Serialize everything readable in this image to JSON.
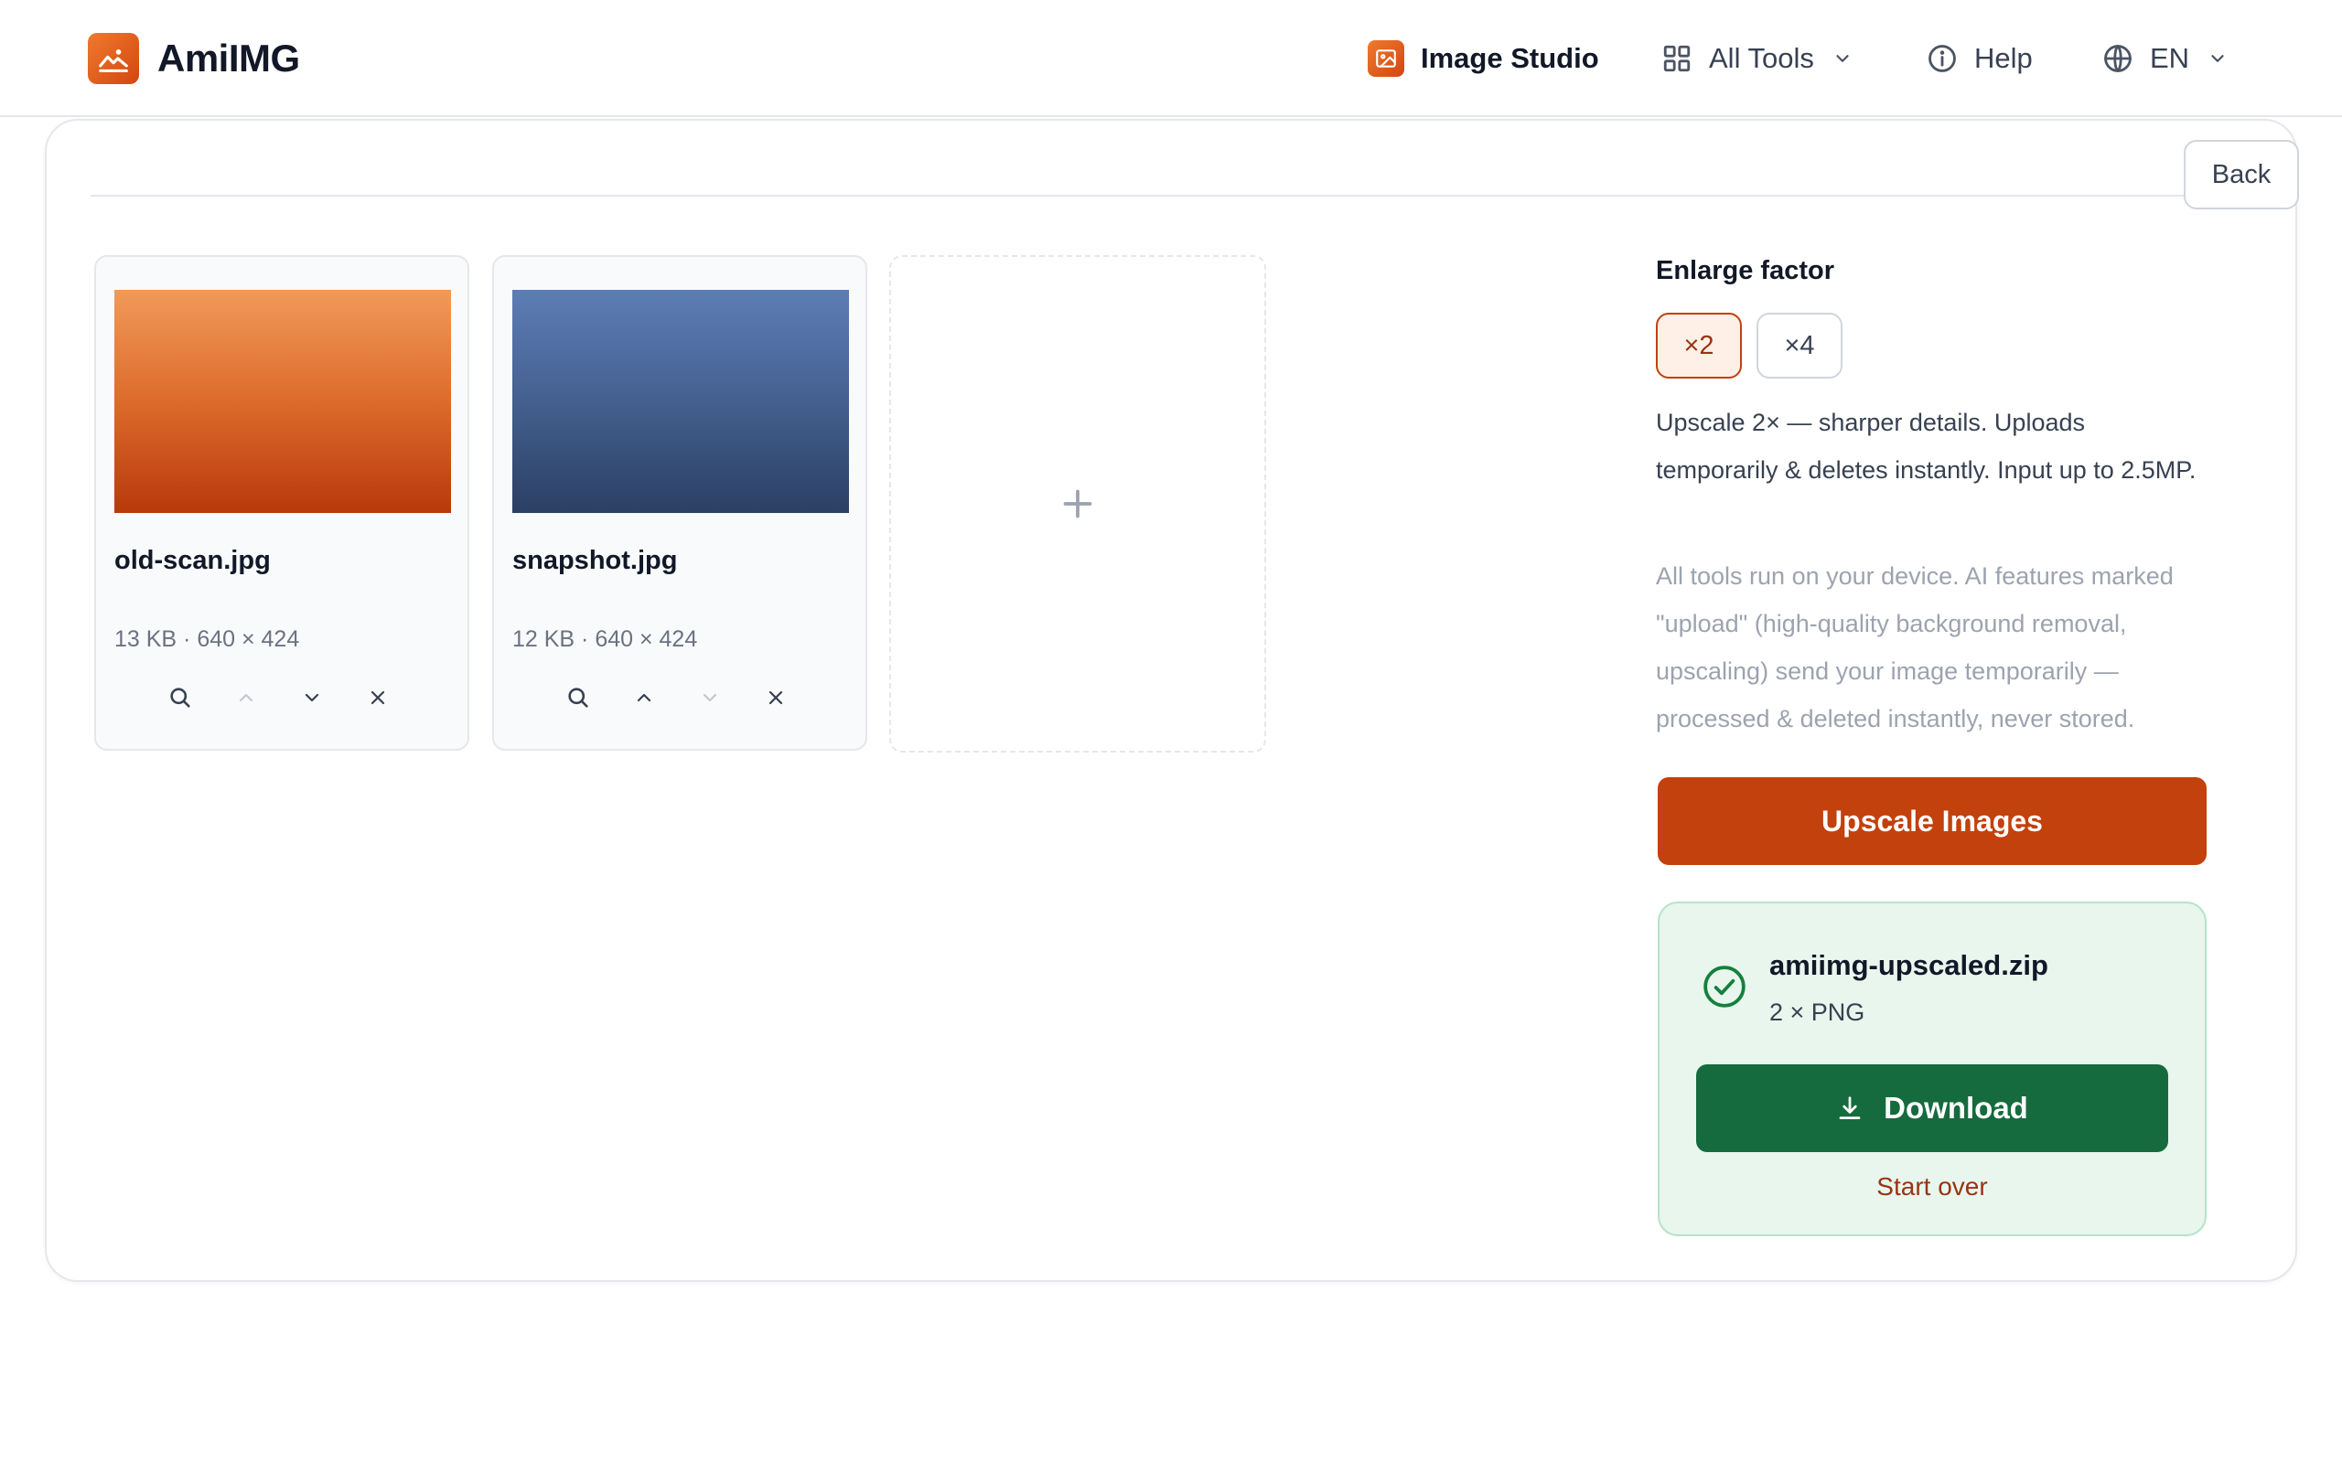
{
  "header": {
    "brand_name": "AmiIMG",
    "nav": {
      "studio_label": "Image Studio",
      "tools_label": "All Tools",
      "help_label": "Help",
      "lang_label": "EN"
    }
  },
  "toolbar": {
    "back_label": "Back"
  },
  "files": [
    {
      "name": "old-scan.jpg",
      "meta": "13 KB · 640 × 424",
      "thumb": "orange-gradient"
    },
    {
      "name": "snapshot.jpg",
      "meta": "12 KB · 640 × 424",
      "thumb": "blue-gradient"
    }
  ],
  "add_tile": {
    "icon": "plus-icon"
  },
  "options": {
    "factor_label": "Enlarge factor",
    "factors": [
      "×2",
      "×4"
    ],
    "selected_factor": "×2",
    "description": "Upscale 2× — sharper details. Uploads temporarily & deletes instantly. Input up to 2.5MP.",
    "privacy_note": "All tools run on your device. AI features marked \"upload\" (high-quality background removal, upscaling) send your image temporarily — processed & deleted instantly, never stored."
  },
  "actions": {
    "upscale_label": "Upscale Images"
  },
  "result": {
    "filename": "amiimg-upscaled.zip",
    "summary": "2 × PNG",
    "download_label": "Download",
    "start_over_label": "Start over"
  },
  "colors": {
    "accent": "#c2410c",
    "accent_soft": "#fef0e6",
    "success": "#166b3e",
    "success_bg": "#e8f6ee"
  }
}
